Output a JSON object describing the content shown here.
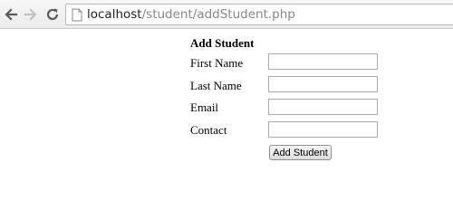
{
  "browser": {
    "url_host": "localhost",
    "url_path": "/student/addStudent.php"
  },
  "form": {
    "title": "Add Student",
    "fields": [
      {
        "label": "First Name",
        "value": ""
      },
      {
        "label": "Last Name",
        "value": ""
      },
      {
        "label": "Email",
        "value": ""
      },
      {
        "label": "Contact",
        "value": ""
      }
    ],
    "submit_label": "Add Student"
  }
}
